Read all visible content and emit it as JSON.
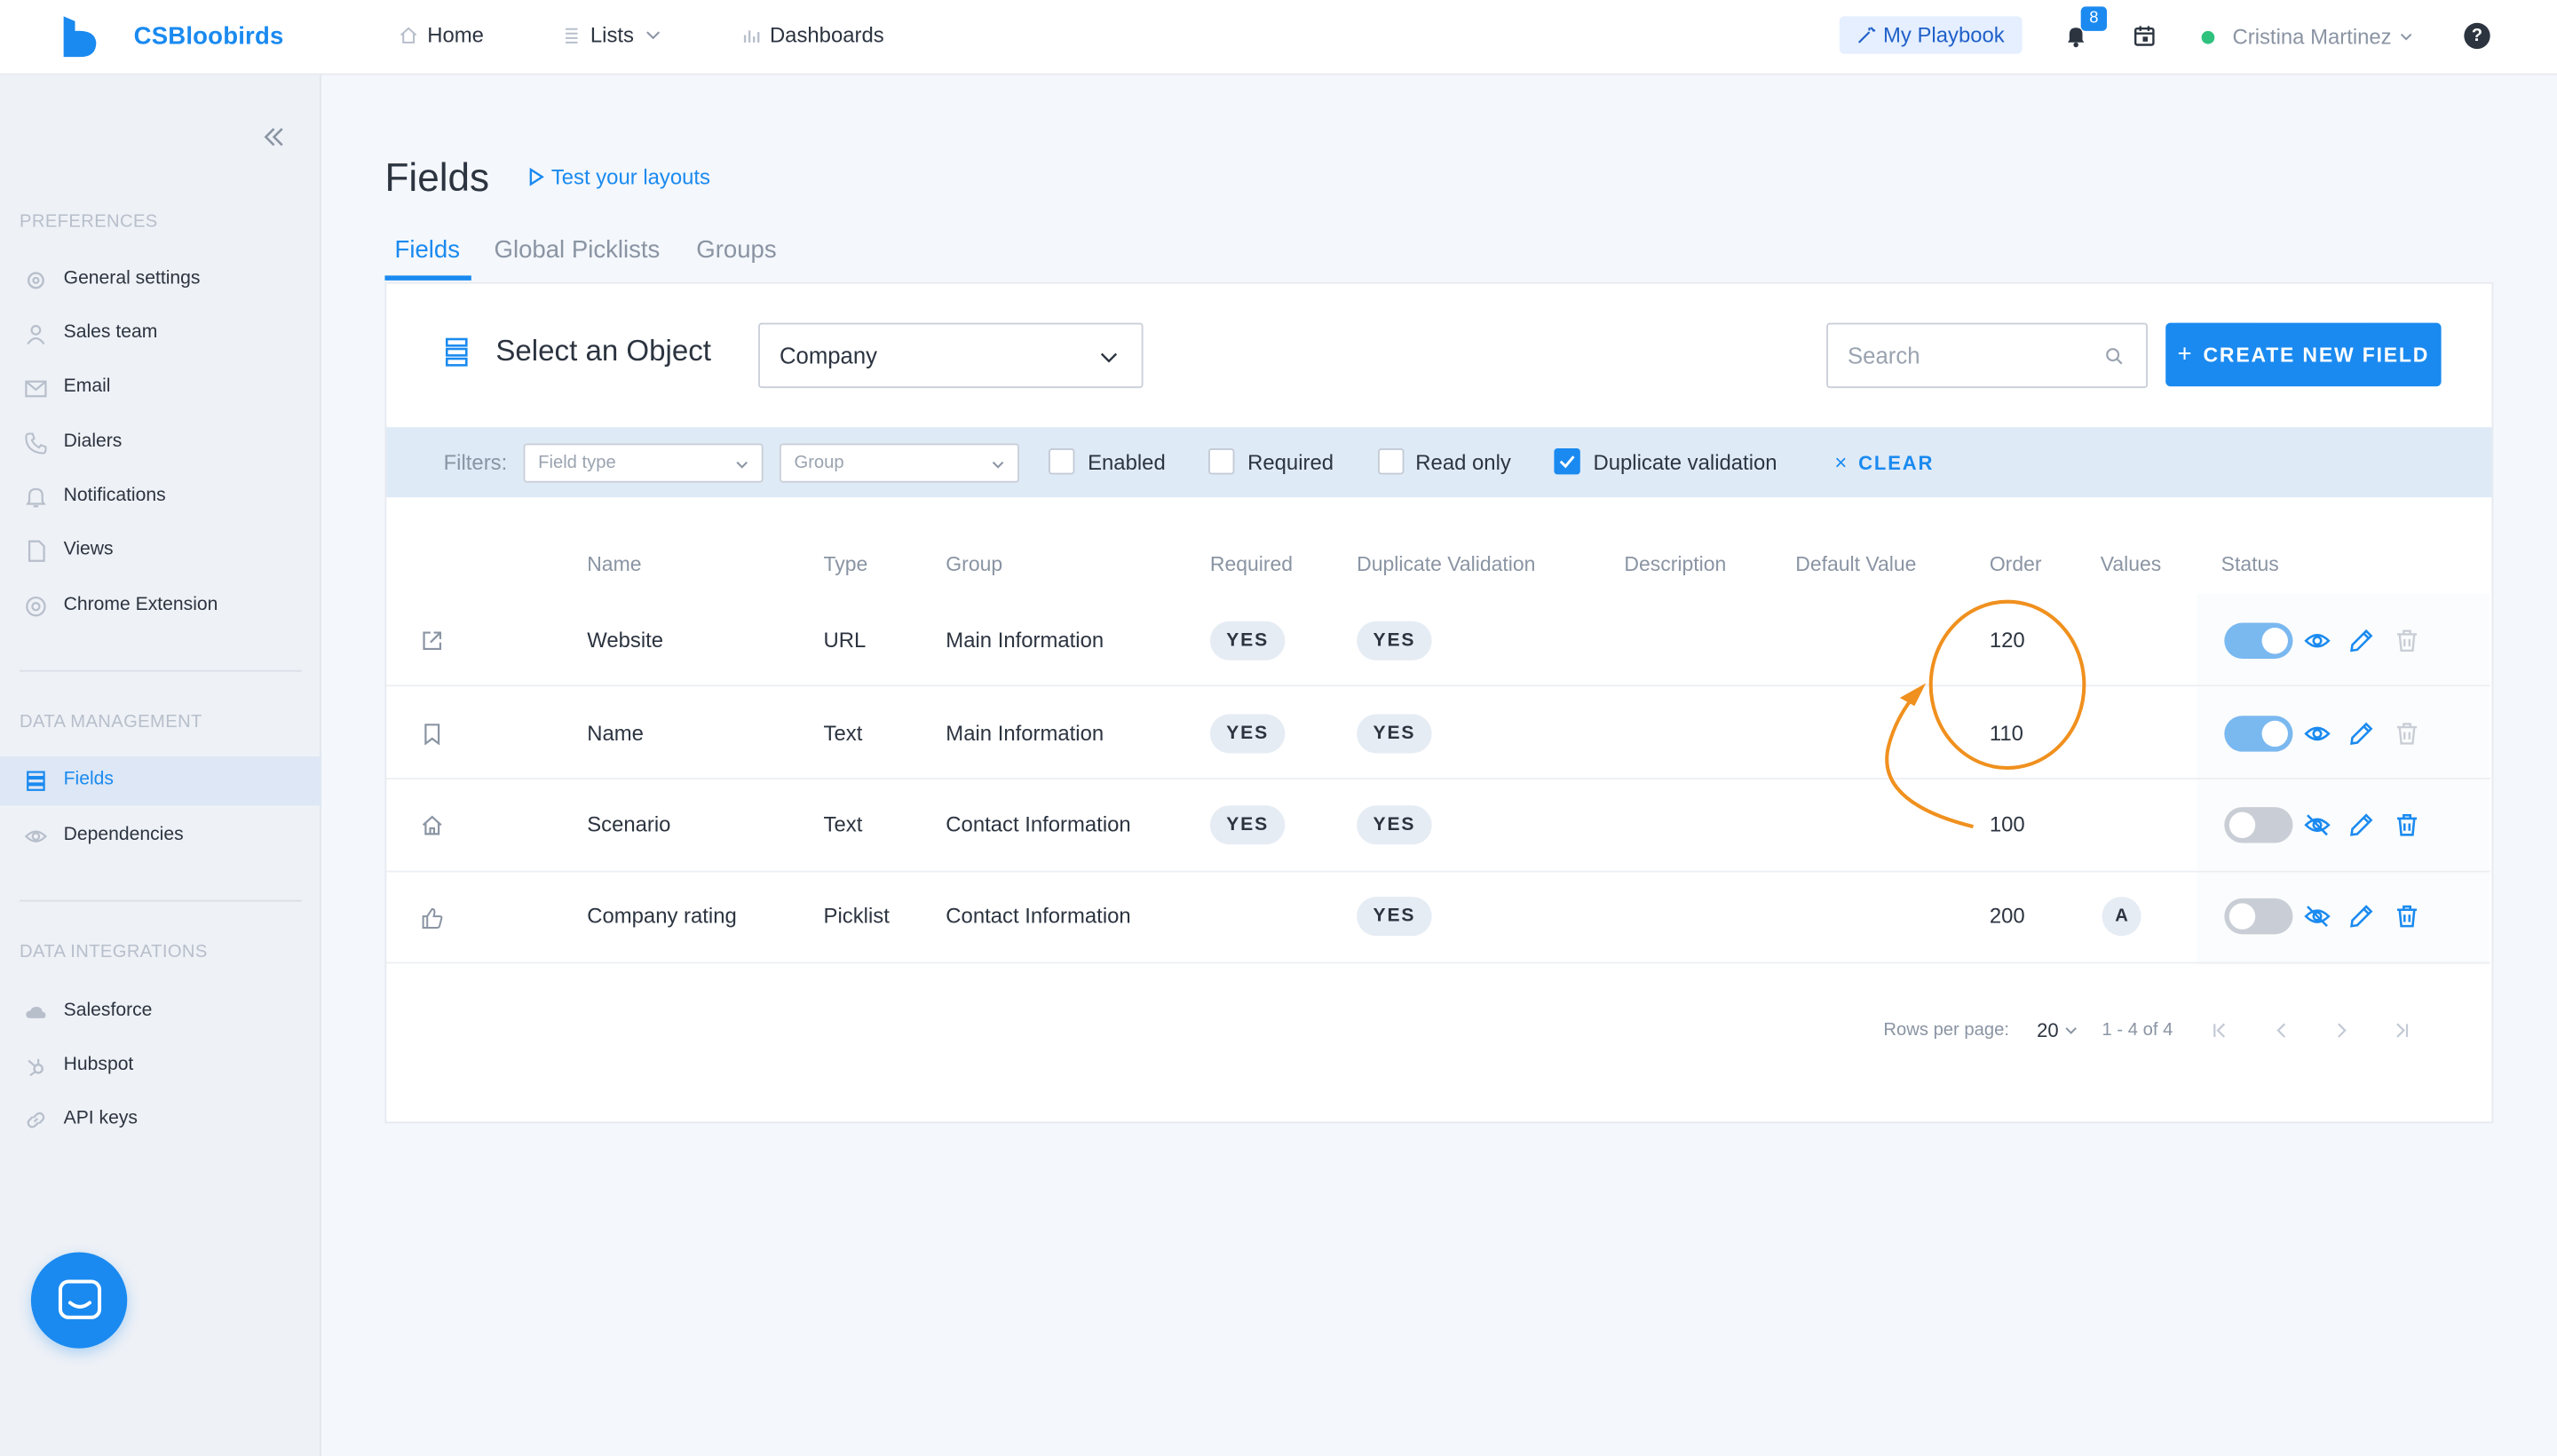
{
  "app": {
    "brand": "CSBloobirds",
    "nav": {
      "home": "Home",
      "lists": "Lists",
      "dashboards": "Dashboards"
    },
    "playbook": "My Playbook",
    "notifications_count": "8",
    "user_name": "Cristina Martinez",
    "help": "?"
  },
  "sidebar": {
    "sections": {
      "preferences": "PREFERENCES",
      "data_management": "DATA MANAGEMENT",
      "data_integrations": "DATA INTEGRATIONS"
    },
    "preferences": [
      {
        "label": "General settings",
        "icon": "gear-icon"
      },
      {
        "label": "Sales team",
        "icon": "user-icon"
      },
      {
        "label": "Email",
        "icon": "mail-icon"
      },
      {
        "label": "Dialers",
        "icon": "phone-icon"
      },
      {
        "label": "Notifications",
        "icon": "bell-icon"
      },
      {
        "label": "Views",
        "icon": "document-icon"
      },
      {
        "label": "Chrome Extension",
        "icon": "chrome-icon"
      }
    ],
    "data_management": [
      {
        "label": "Fields",
        "icon": "list-icon",
        "active": true
      },
      {
        "label": "Dependencies",
        "icon": "eye-icon"
      }
    ],
    "data_integrations": [
      {
        "label": "Salesforce",
        "icon": "cloud-icon"
      },
      {
        "label": "Hubspot",
        "icon": "hubspot-icon"
      },
      {
        "label": "API keys",
        "icon": "link-icon"
      }
    ]
  },
  "page": {
    "title": "Fields",
    "test_link": "Test your layouts",
    "tabs": [
      "Fields",
      "Global Picklists",
      "Groups"
    ],
    "active_tab": "Fields"
  },
  "toolbar": {
    "select_label": "Select an Object",
    "selected_object": "Company",
    "search_placeholder": "Search",
    "create_button": "CREATE NEW FIELD"
  },
  "filters": {
    "label": "Filters:",
    "field_type_placeholder": "Field type",
    "group_placeholder": "Group",
    "checkboxes": [
      {
        "label": "Enabled",
        "checked": false
      },
      {
        "label": "Required",
        "checked": false
      },
      {
        "label": "Read only",
        "checked": false
      },
      {
        "label": "Duplicate validation",
        "checked": true
      }
    ],
    "clear": "CLEAR"
  },
  "table": {
    "columns": [
      "Name",
      "Type",
      "Group",
      "Required",
      "Duplicate Validation",
      "Description",
      "Default Value",
      "Order",
      "Values",
      "Status"
    ],
    "rows": [
      {
        "icon": "external-link-icon",
        "name": "Website",
        "type": "URL",
        "group": "Main Information",
        "required": "YES",
        "duplicate_validation": "YES",
        "description": "",
        "default_value": "",
        "order": "120",
        "values": "",
        "enabled": true
      },
      {
        "icon": "bookmark-icon",
        "name": "Name",
        "type": "Text",
        "group": "Main Information",
        "required": "YES",
        "duplicate_validation": "YES",
        "description": "",
        "default_value": "",
        "order": "110",
        "values": "",
        "enabled": true
      },
      {
        "icon": "home-icon",
        "name": "Scenario",
        "type": "Text",
        "group": "Contact Information",
        "required": "YES",
        "duplicate_validation": "YES",
        "description": "",
        "default_value": "",
        "order": "100",
        "values": "",
        "enabled": false
      },
      {
        "icon": "thumbs-up-icon",
        "name": "Company rating",
        "type": "Picklist",
        "group": "Contact Information",
        "required": "",
        "duplicate_validation": "YES",
        "description": "",
        "default_value": "",
        "order": "200",
        "values": "A",
        "enabled": false
      }
    ]
  },
  "pagination": {
    "rows_per_page_label": "Rows per page:",
    "rows_per_page": "20",
    "range": "1 - 4 of 4"
  },
  "colors": {
    "accent": "#1a8af0",
    "annotation": "#f0901e",
    "sidebar_bg": "#eef1f6",
    "filters_bg": "#dfeaf7"
  }
}
